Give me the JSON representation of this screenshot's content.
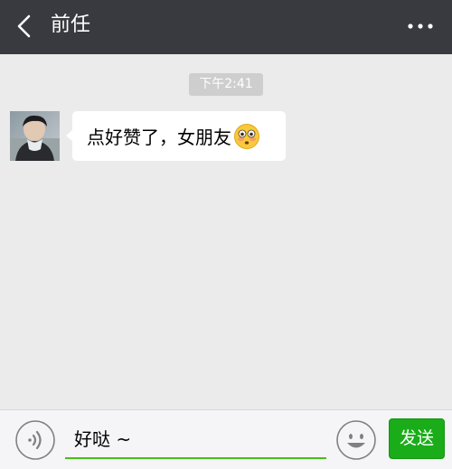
{
  "header": {
    "title": "前任",
    "back_icon": "chevron-left-icon",
    "more_icon": "more-dots-icon",
    "background": "#393a3f"
  },
  "chat": {
    "timestamp": "下午2:41",
    "messages": [
      {
        "sender": "other",
        "avatar_icon": "user-avatar-photo",
        "text": "点好赞了，女朋友",
        "emoji": "flushed-face-emoji"
      }
    ]
  },
  "input_bar": {
    "voice_icon": "voice-icon",
    "value": "好哒 ~",
    "emoji_icon": "smiley-face-icon",
    "send_label": "发送",
    "send_color": "#1aad19",
    "underline_color": "#45c01a"
  }
}
